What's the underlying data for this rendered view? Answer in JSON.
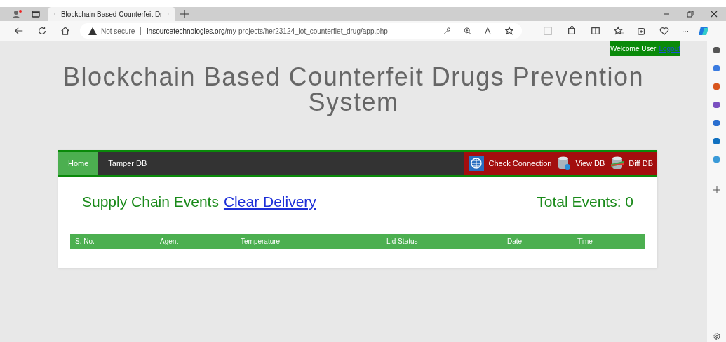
{
  "browser": {
    "tab": {
      "title": "Blockchain Based Counterfeit Dr"
    },
    "address": {
      "security": "Not secure",
      "domain": "insourcetechnologies.org",
      "path": "/my-projects/her23124_iot_counterfiet_drug/app.php"
    },
    "more": "···"
  },
  "header": {
    "welcome": "Welcome User",
    "logout": "Logout",
    "title": "Blockchain Based Counterfeit Drugs Prevention System"
  },
  "nav": {
    "tabs": [
      {
        "label": "Home",
        "selected": true
      },
      {
        "label": "Tamper DB",
        "selected": false
      }
    ],
    "actions": [
      {
        "label": "Check Connection",
        "kind": "globe"
      },
      {
        "label": "View DB",
        "kind": "database"
      },
      {
        "label": "Diff DB",
        "kind": "diff"
      }
    ]
  },
  "events": {
    "heading": "Supply Chain Events",
    "link": "Clear Delivery",
    "total": "Total Events: 0",
    "table": {
      "columns": [
        "S. No.",
        "Agent",
        "Temperature",
        "Lid Status",
        "Date",
        "Time"
      ]
    }
  }
}
